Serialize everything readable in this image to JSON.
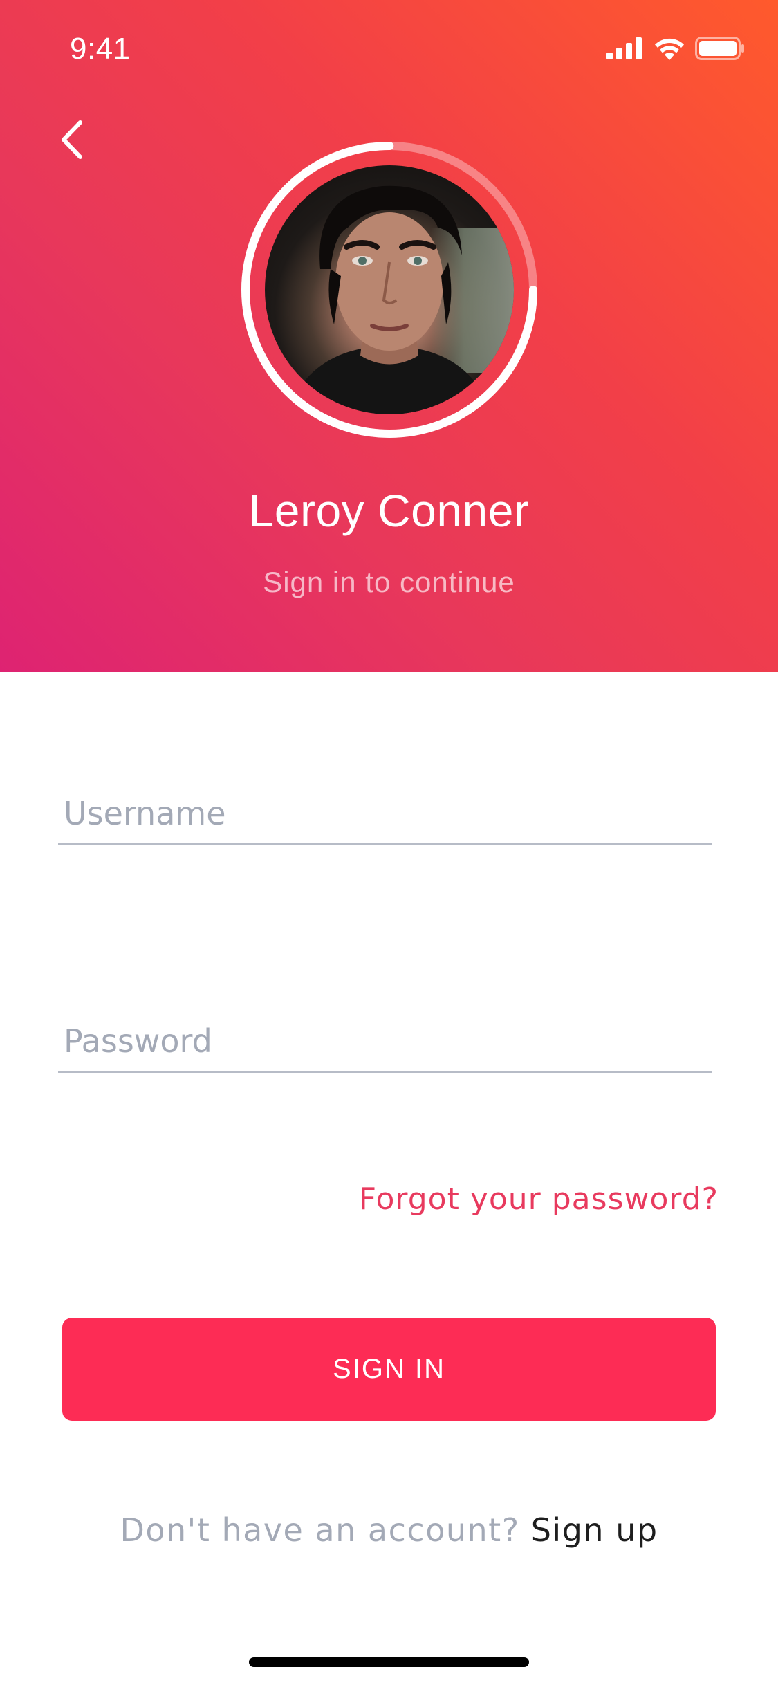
{
  "status_bar": {
    "time": "9:41",
    "icons": [
      "signal-icon",
      "wifi-icon",
      "battery-icon"
    ]
  },
  "header": {
    "back_icon": "chevron-left-icon",
    "user_name": "Leroy Conner",
    "subtitle": "Sign in to continue",
    "profile_progress": 0.75
  },
  "form": {
    "username_placeholder": "Username",
    "username_value": "",
    "password_placeholder": "Password",
    "password_value": "",
    "forgot_label": "Forgot your password?",
    "sign_in_label": "SIGN IN"
  },
  "footer": {
    "prompt": "Don't have an account?",
    "signup_label": "Sign up"
  },
  "colors": {
    "gradient_start": "#ff5a2c",
    "gradient_end": "#de2372",
    "accent": "#fd2c55",
    "link": "#e83a5e",
    "placeholder": "#a3a9b6",
    "underline": "#b7bcc7"
  }
}
